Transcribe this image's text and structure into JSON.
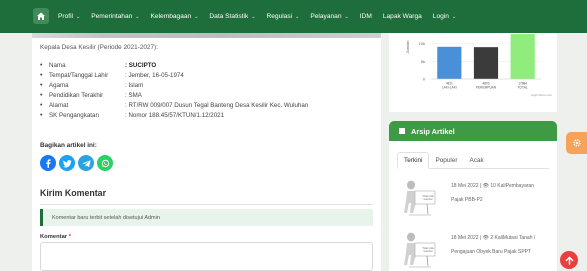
{
  "nav": {
    "items": [
      {
        "label": "Profil",
        "caret": true
      },
      {
        "label": "Pemerintahan",
        "caret": true
      },
      {
        "label": "Kelembagaan",
        "caret": true
      },
      {
        "label": "Data Statistik",
        "caret": true
      },
      {
        "label": "Regulasi",
        "caret": true
      },
      {
        "label": "Pelayanan",
        "caret": true
      },
      {
        "label": "IDM",
        "caret": false
      },
      {
        "label": "Lapak Warga",
        "caret": false
      },
      {
        "label": "Login",
        "caret": true
      }
    ],
    "caret_glyph": "⌄",
    "color": "#1e6e3c"
  },
  "article": {
    "kepala_text": "Kepala Desa Kesilir (Periode 2021-2027):",
    "bullet": "•",
    "info": [
      {
        "label": "Nama",
        "value": ": SUCIPTO",
        "bold": true
      },
      {
        "label": "Tempat/Tanggal Lahir",
        "value": ": Jember, 16-05-1974",
        "bold": false
      },
      {
        "label": "Agama",
        "value": ": Islam",
        "bold": false
      },
      {
        "label": "Pendidikan Terakhir",
        "value": ": SMA",
        "bold": false
      },
      {
        "label": "Alamat",
        "value": ": RT/RW 009/007 Dusun Tegal Banteng Desa Kesilir Kec. Wuluhan",
        "bold": false
      },
      {
        "label": "SK Pengangkatan",
        "value": ": Nomor 188.45/57/KTUN/1.12/2021",
        "bold": false
      }
    ],
    "share_label": "Bagikan artikel ini:",
    "share_icons": [
      {
        "name": "facebook-icon",
        "color": "#1877f2"
      },
      {
        "name": "twitter-icon",
        "color": "#1da1f2"
      },
      {
        "name": "telegram-icon",
        "color": "#2aa3df"
      },
      {
        "name": "whatsapp-icon",
        "color": "#25d366"
      }
    ],
    "kirim_komentar": "Kirim Komentar",
    "alert_text": "Komentar baru terbit setelah disetujui Admin",
    "komentar_label": "Komentar",
    "required_mark": "*"
  },
  "chart_data": {
    "type": "bar",
    "ylabel": "Jumlah",
    "yticks": [
      "0",
      "5k",
      "10k"
    ],
    "ylim": [
      0,
      13000
    ],
    "categories": [
      "LAKI-LAKI",
      "PEREMPUAN",
      "TOTAL"
    ],
    "category_top": [
      "4811",
      "4803",
      "17884"
    ],
    "values": [
      9100,
      9000,
      12700
    ],
    "colors": [
      "#4a90d9",
      "#3b3b3b",
      "#90ed7d"
    ],
    "credit": "Highcharts.com"
  },
  "arsip": {
    "title": "Arsip Artikel",
    "tabs": [
      "Terkini",
      "Populer",
      "Acak"
    ],
    "active_tab": 0,
    "articles": [
      {
        "meta": "18  Mei  2022  |  👁  10  KaliPembayaran",
        "title": "Pajak PBB-P2",
        "thumb_text": "Tidak Ada Gambar"
      },
      {
        "meta": "18  Mei  2022  |  👁  2  KaliMutasi  Tanah  /",
        "title": "Pengajuan Obyek Baru Pajak SPPT",
        "thumb_text": "Tidak Ada Gambar"
      }
    ],
    "header_color": "#3f9a45"
  },
  "floats": {
    "gear_color": "#f5a35a",
    "up_color": "#e8403f"
  }
}
